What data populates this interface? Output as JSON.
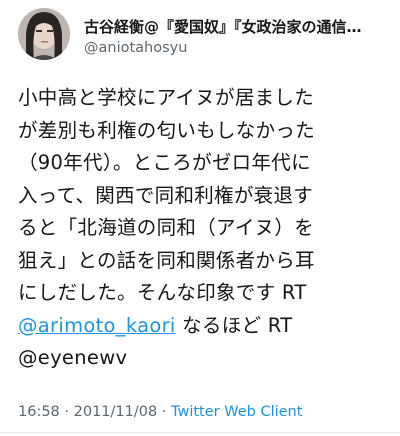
{
  "tweet": {
    "display_name": "古谷経衡@『愛国奴』『女政治家の通信…",
    "handle": "@aniotahosyu",
    "lines": [
      "小中高と学校にアイヌが居ました",
      "が差別も利権の匂いもしなかった",
      "（90年代）。ところがゼロ年代に",
      "入って、関西で同和利権が衰退す",
      "ると「北海道の同和（アイヌ）を",
      "狙え」との話を同和関係者から耳",
      "にしだした。そんな印象です RT"
    ],
    "mention_line": {
      "mention": "@arimoto_kaori",
      "rest": " なるほど RT"
    },
    "last_line": "@eyenewv",
    "time": "16:58",
    "separator": " · ",
    "date": "2011/11/08",
    "source": "Twitter Web Client"
  }
}
